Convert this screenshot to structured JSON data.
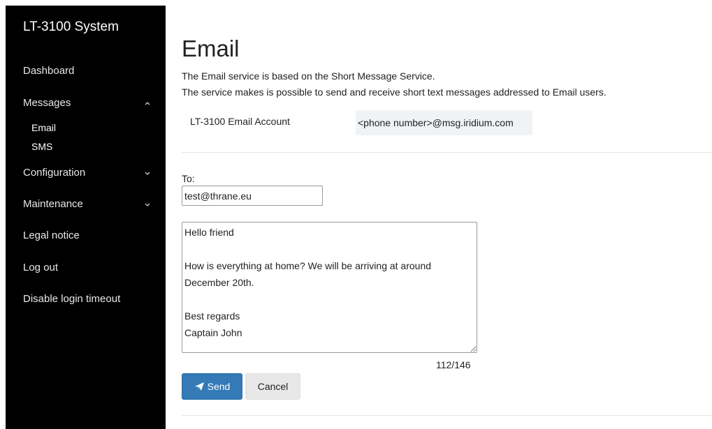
{
  "sidebar": {
    "brand": "LT-3100 System",
    "items": [
      {
        "label": "Dashboard"
      },
      {
        "label": "Messages",
        "expanded": true,
        "chevron": "chevron-up-icon"
      },
      {
        "label": "Configuration",
        "chevron": "chevron-down-icon"
      },
      {
        "label": "Maintenance",
        "chevron": "chevron-down-icon"
      },
      {
        "label": "Legal notice"
      },
      {
        "label": "Log out"
      },
      {
        "label": "Disable login timeout"
      }
    ],
    "messages_sub": [
      {
        "label": "Email"
      },
      {
        "label": "SMS"
      }
    ]
  },
  "main": {
    "title": "Email",
    "desc_line1": "The Email service is based on the Short Message Service.",
    "desc_line2": "The service makes is possible to send and receive short text messages addressed to Email users.",
    "account_label": "LT-3100 Email Account",
    "account_value": "<phone number>@msg.iridium.com",
    "to_label": "To:",
    "to_value": "test@thrane.eu",
    "message_value": "Hello friend\n\nHow is everything at home? We will be arriving at around December 20th.\n\nBest regards\nCaptain John",
    "counter": "112/146",
    "send_label": "Send",
    "cancel_label": "Cancel"
  },
  "colors": {
    "sidebar_bg": "#000000",
    "primary": "#337ab7",
    "account_bg": "#f0f3f6"
  }
}
